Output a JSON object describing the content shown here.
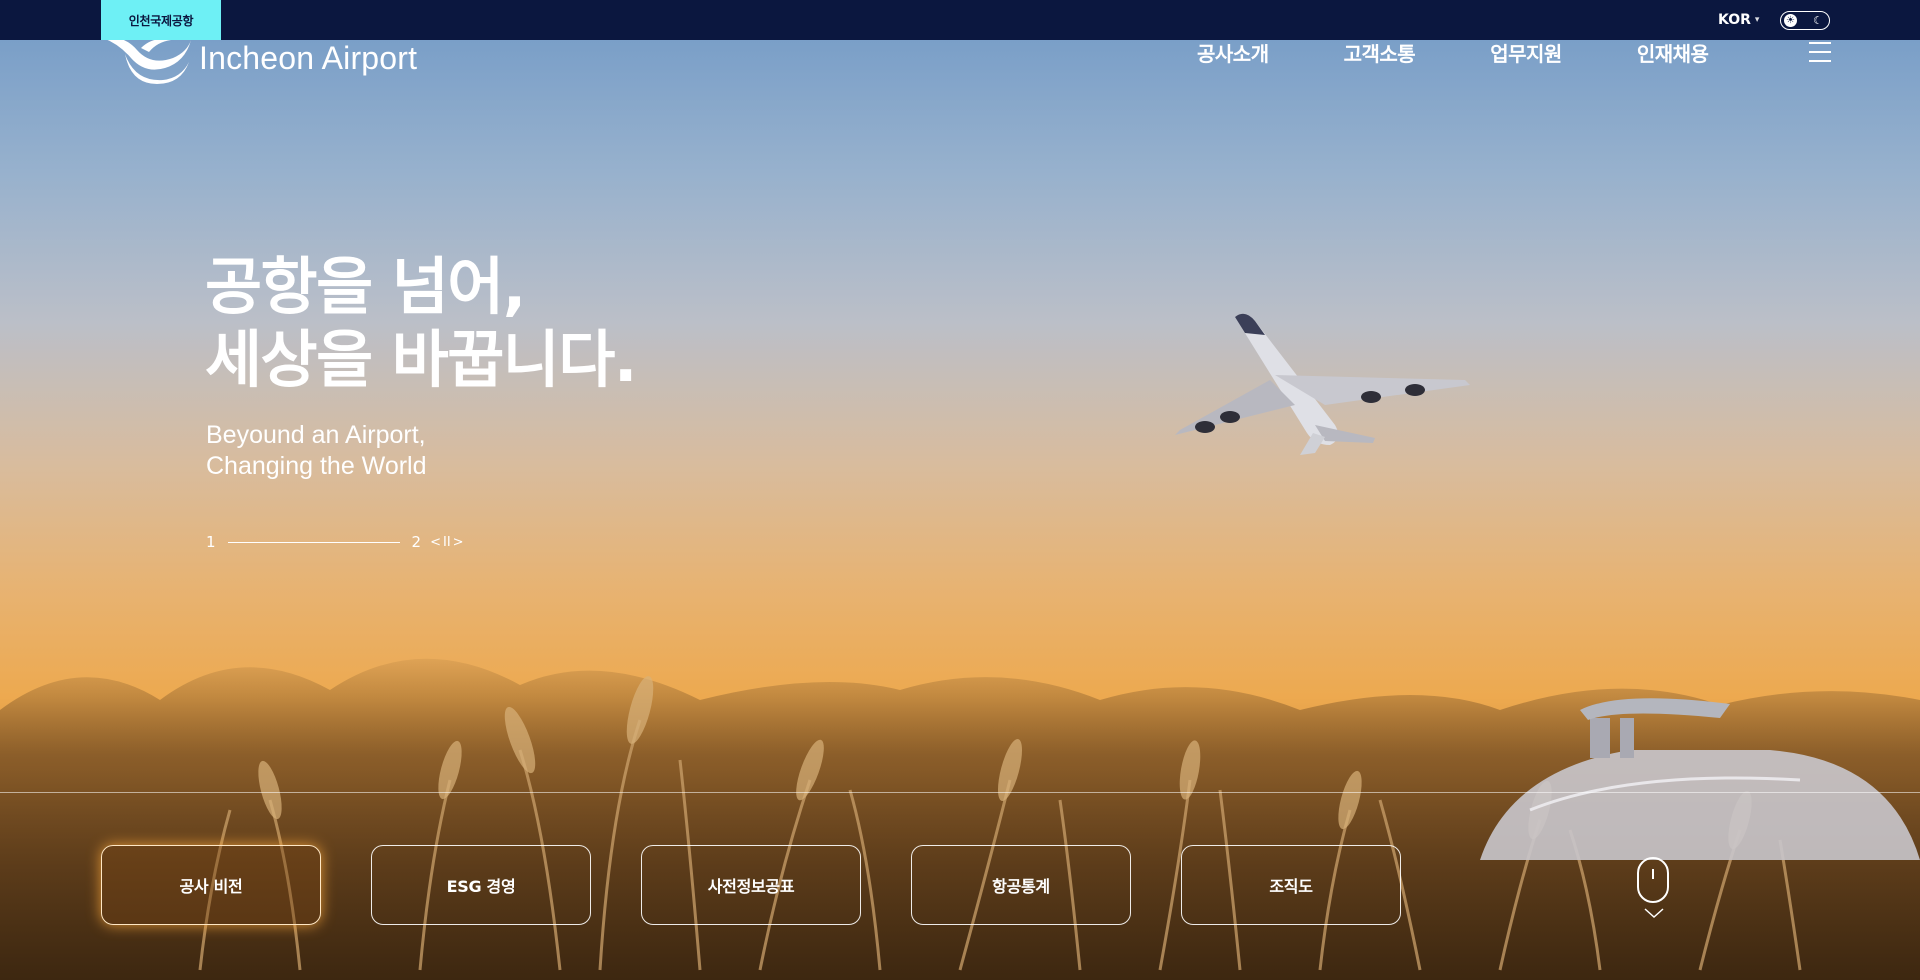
{
  "topbar": {
    "site_tab": "인천국제공항",
    "language": "KOR",
    "theme_icons": [
      "sun-icon",
      "moon-icon"
    ]
  },
  "header": {
    "logo_text": "Incheon Airport",
    "nav": [
      "공사소개",
      "고객소통",
      "업무지원",
      "인재채용"
    ]
  },
  "hero": {
    "headline": "공항을 넘어,\n세상을 바꿉니다.",
    "subline": "Beyound an Airport,\nChanging the World",
    "pager": {
      "current": "1",
      "total": "2",
      "prev": "<",
      "pause": "II",
      "next": ">"
    }
  },
  "quick_links": [
    "공사 비전",
    "ESG 경영",
    "사전정보공표",
    "항공통계",
    "조직도"
  ],
  "colors": {
    "topbar": "#0b173f",
    "site_tab": "#6ef0f5",
    "text": "#ffffff"
  }
}
